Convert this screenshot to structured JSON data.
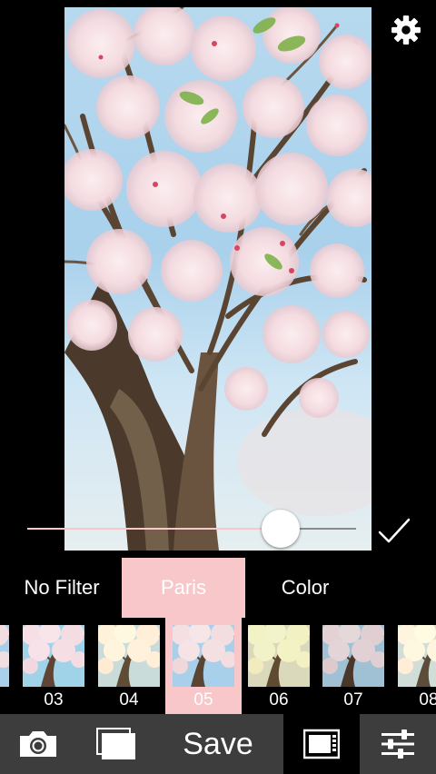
{
  "category_tabs": [
    {
      "label": "No Filter",
      "active": false
    },
    {
      "label": "Paris",
      "active": true
    },
    {
      "label": "Color",
      "active": false
    }
  ],
  "filters": [
    {
      "number": "",
      "active": false
    },
    {
      "number": "03",
      "active": false
    },
    {
      "number": "04",
      "active": false
    },
    {
      "number": "05",
      "active": true
    },
    {
      "number": "06",
      "active": false
    },
    {
      "number": "07",
      "active": false
    },
    {
      "number": "08",
      "active": false
    }
  ],
  "slider": {
    "value": 0.77
  },
  "toolbar": {
    "save_label": "Save"
  },
  "icons": {
    "settings": "gear-icon",
    "confirm": "checkmark-icon",
    "camera": "camera-icon",
    "album": "album-icon",
    "frame": "film-frame-icon",
    "adjust": "sliders-icon"
  },
  "colors": {
    "accent": "#f7c7c9",
    "toolbar": "#3d3d3d",
    "background": "#000000"
  }
}
